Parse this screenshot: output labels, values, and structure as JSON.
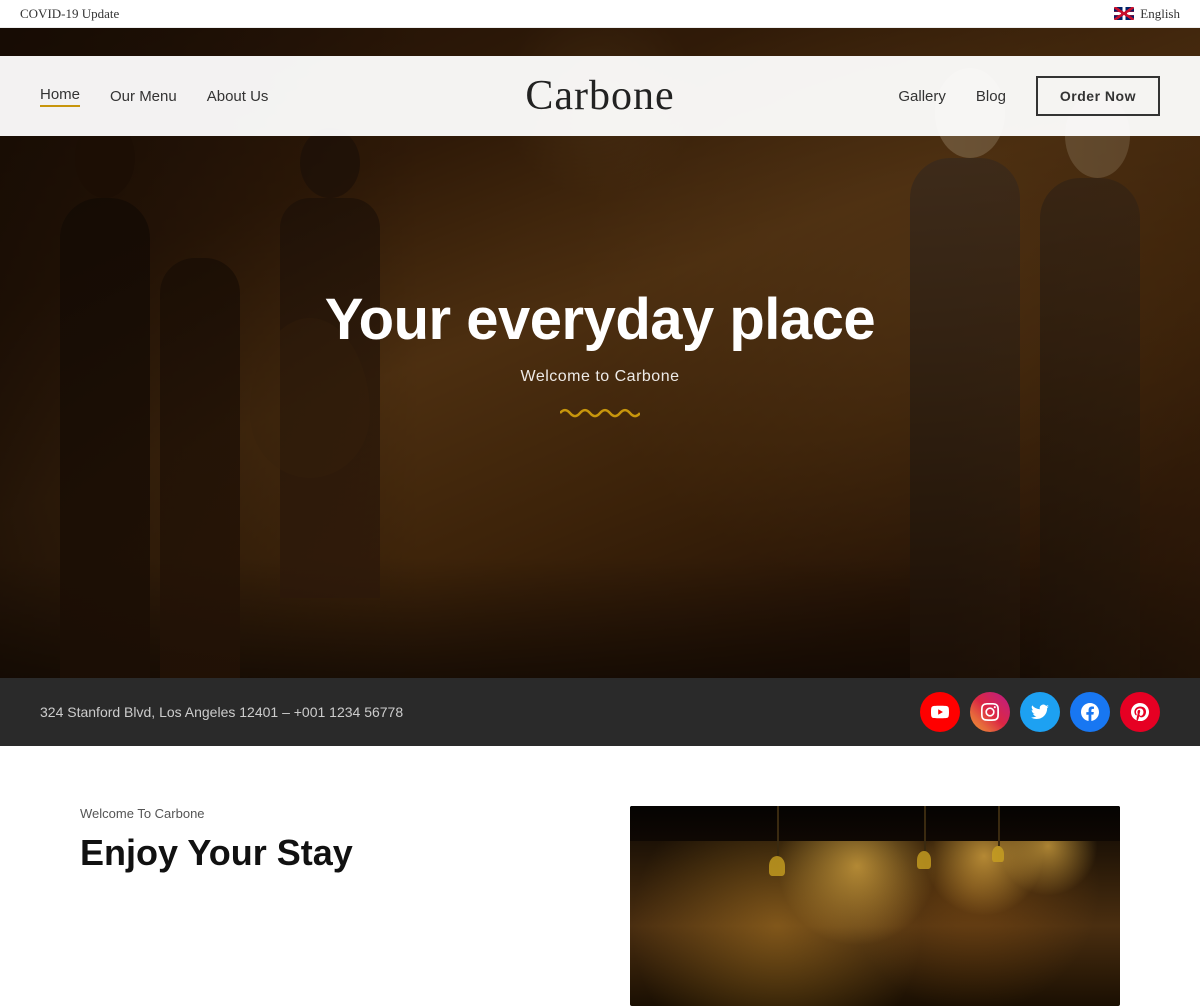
{
  "topbar": {
    "covid_label": "COVID-19 Update",
    "language": "English"
  },
  "navbar": {
    "brand": "Carbone",
    "nav_left": [
      {
        "label": "Home",
        "active": true
      },
      {
        "label": "Our Menu",
        "active": false
      },
      {
        "label": "About Us",
        "active": false
      }
    ],
    "nav_right": [
      {
        "label": "Gallery"
      },
      {
        "label": "Blog"
      }
    ],
    "order_button": "Order Now"
  },
  "hero": {
    "title": "Your everyday place",
    "subtitle": "Welcome to Carbone"
  },
  "infobar": {
    "address": "324 Stanford Blvd, Los Angeles 12401 – +001 1234 56778",
    "social": [
      {
        "name": "YouTube",
        "icon": "▶",
        "class": "si-youtube"
      },
      {
        "name": "Instagram",
        "icon": "◉",
        "class": "si-instagram"
      },
      {
        "name": "Twitter",
        "icon": "🐦",
        "class": "si-twitter"
      },
      {
        "name": "Facebook",
        "icon": "f",
        "class": "si-facebook"
      },
      {
        "name": "Pinterest",
        "icon": "P",
        "class": "si-pinterest"
      }
    ]
  },
  "below_fold": {
    "tag": "Welcome To Carbone",
    "heading": "Enjoy Your Stay"
  }
}
